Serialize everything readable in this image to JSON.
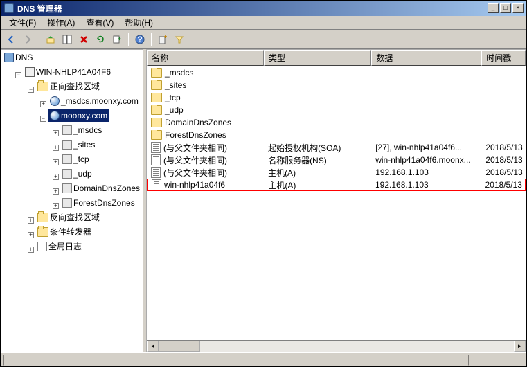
{
  "window": {
    "title": "DNS 管理器"
  },
  "menu": {
    "file": "文件(F)",
    "action": "操作(A)",
    "view": "查看(V)",
    "help": "帮助(H)"
  },
  "win_controls": {
    "min": "_",
    "max": "□",
    "close": "×"
  },
  "tree": {
    "root": "DNS",
    "server": "WIN-NHLP41A04F6",
    "fwd_lookup": "正向查找区域",
    "rev_lookup": "反向查找区域",
    "cond_fwd": "条件转发器",
    "global_log": "全局日志",
    "zone_msdcs": "_msdcs.moonxy.com",
    "zone_moonxy": "moonxy.com",
    "sub_msdcs": "_msdcs",
    "sub_sites": "_sites",
    "sub_tcp": "_tcp",
    "sub_udp": "_udp",
    "sub_ddz": "DomainDnsZones",
    "sub_fdz": "ForestDnsZones"
  },
  "list": {
    "headers": {
      "name": "名称",
      "type": "类型",
      "data": "数据",
      "timestamp": "时间戳"
    },
    "rows": [
      {
        "icon": "folder",
        "name": "_msdcs",
        "type": "",
        "data": "",
        "ts": ""
      },
      {
        "icon": "folder",
        "name": "_sites",
        "type": "",
        "data": "",
        "ts": ""
      },
      {
        "icon": "folder",
        "name": "_tcp",
        "type": "",
        "data": "",
        "ts": ""
      },
      {
        "icon": "folder",
        "name": "_udp",
        "type": "",
        "data": "",
        "ts": ""
      },
      {
        "icon": "folder",
        "name": "DomainDnsZones",
        "type": "",
        "data": "",
        "ts": ""
      },
      {
        "icon": "folder",
        "name": "ForestDnsZones",
        "type": "",
        "data": "",
        "ts": ""
      },
      {
        "icon": "record",
        "name": "(与父文件夹相同)",
        "type": "起始授权机构(SOA)",
        "data": "[27], win-nhlp41a04f6...",
        "ts": "2018/5/13"
      },
      {
        "icon": "record",
        "name": "(与父文件夹相同)",
        "type": "名称服务器(NS)",
        "data": "win-nhlp41a04f6.moonx...",
        "ts": "2018/5/13"
      },
      {
        "icon": "record",
        "name": "(与父文件夹相同)",
        "type": "主机(A)",
        "data": "192.168.1.103",
        "ts": "2018/5/13"
      },
      {
        "icon": "record",
        "name": "win-nhlp41a04f6",
        "type": "主机(A)",
        "data": "192.168.1.103",
        "ts": "2018/5/13",
        "highlighted": true
      }
    ]
  },
  "tree_toggle": {
    "plus": "+",
    "minus": "−"
  }
}
